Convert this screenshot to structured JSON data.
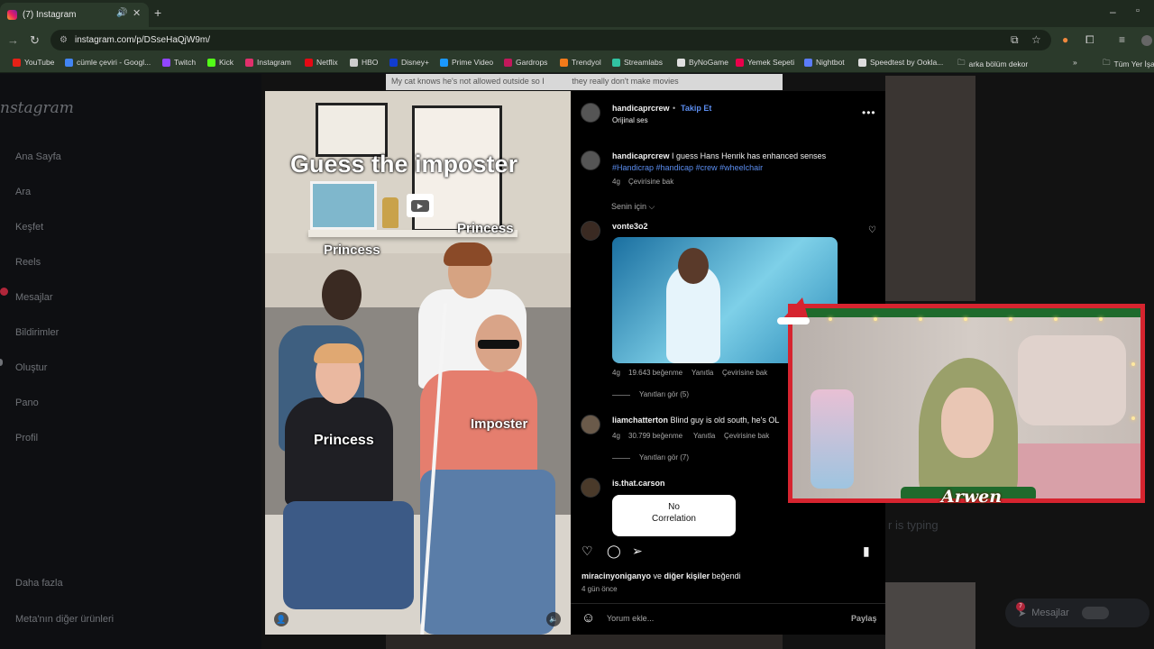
{
  "browser": {
    "tab_title": "(7) Instagram",
    "url": "instagram.com/p/DSseHaQjW9m/",
    "bookmarks": [
      {
        "label": "YouTube",
        "color": "#e62117"
      },
      {
        "label": "cümle çeviri - Googl...",
        "color": "#4285f4"
      },
      {
        "label": "Twitch",
        "color": "#9146ff"
      },
      {
        "label": "Kick",
        "color": "#53fc18"
      },
      {
        "label": "Instagram",
        "color": "#e1306c"
      },
      {
        "label": "Netflix",
        "color": "#e50914"
      },
      {
        "label": "HBO",
        "color": "#cccccc"
      },
      {
        "label": "Disney+",
        "color": "#113ccf"
      },
      {
        "label": "Prime Video",
        "color": "#1a98ff"
      },
      {
        "label": "Gardrops",
        "color": "#c2185b"
      },
      {
        "label": "Trendyol",
        "color": "#f27a1a"
      },
      {
        "label": "Streamlabs",
        "color": "#31c3a2"
      },
      {
        "label": "ByNoGame",
        "color": "#e0e0e0"
      },
      {
        "label": "Yemek Sepeti",
        "color": "#ea004b"
      },
      {
        "label": "Nightbot",
        "color": "#5b7cfa"
      },
      {
        "label": "Speedtest by Ookla...",
        "color": "#dddddd"
      }
    ],
    "folder_arka": "arka bölüm dekor",
    "folder_all": "Tüm Yer İşa"
  },
  "sidebar": {
    "logo": "nstagram",
    "items": [
      "Ana Sayfa",
      "Ara",
      "Keşfet",
      "Reels",
      "Mesajlar",
      "Bildirimler",
      "Oluştur",
      "Pano",
      "Profil"
    ],
    "more": "Daha fazla",
    "meta": "Meta'nın diğer ürünleri"
  },
  "background": {
    "feed_caption": "My cat knows he's not allowed outside so I",
    "feed_caption2": "they really don't make movies",
    "typing_hint": "r is typing",
    "messages_label": "Mesajlar",
    "messages_count": "7"
  },
  "video": {
    "title": "Guess the imposter",
    "labels": [
      "Princess",
      "Princess",
      "Princess",
      "Imposter"
    ]
  },
  "post": {
    "username": "handicaprcrew",
    "follow": "Takip Et",
    "audio": "Orijinal ses",
    "caption_user": "handicaprcrew",
    "caption_text": "I guess Hans Henrik has enhanced senses",
    "hashtags": "#Handicrap #handicap #crew #wheelchair",
    "caption_age": "4g",
    "caption_translate": "Çevirisine bak",
    "sort": "Senin için",
    "comments": [
      {
        "user": "vonte3o2",
        "age": "4g",
        "likes": "19.643 beğenme",
        "reply": "Yanıtla",
        "translate": "Çevirisine bak",
        "replies": "Yanıtları gör (5)"
      },
      {
        "user": "liamchatterton",
        "text": "Blind guy is old south, he's OL",
        "age": "4g",
        "likes": "30.799 beğenme",
        "reply": "Yanıtla",
        "translate": "Çevirisine bak",
        "replies": "Yanıtları gör (7)"
      },
      {
        "user": "is.that.carson",
        "image_text": "No\nCorrelation"
      }
    ],
    "liked_by": "miracinyoniganyo ve diğer kişiler beğendi",
    "liked_user": "miracinyoniganyo",
    "liked_rest": " ve ",
    "liked_others": "diğer kişiler",
    "liked_end": " beğendi",
    "time": "4 gün önce",
    "comment_placeholder": "Yorum ekle...",
    "share": "Paylaş"
  },
  "overlay": {
    "streamer_name": "Arwen"
  },
  "colors": {
    "accent_blue": "#5b8def",
    "frame_red": "#d6242f",
    "panel_bg": "#000000"
  }
}
